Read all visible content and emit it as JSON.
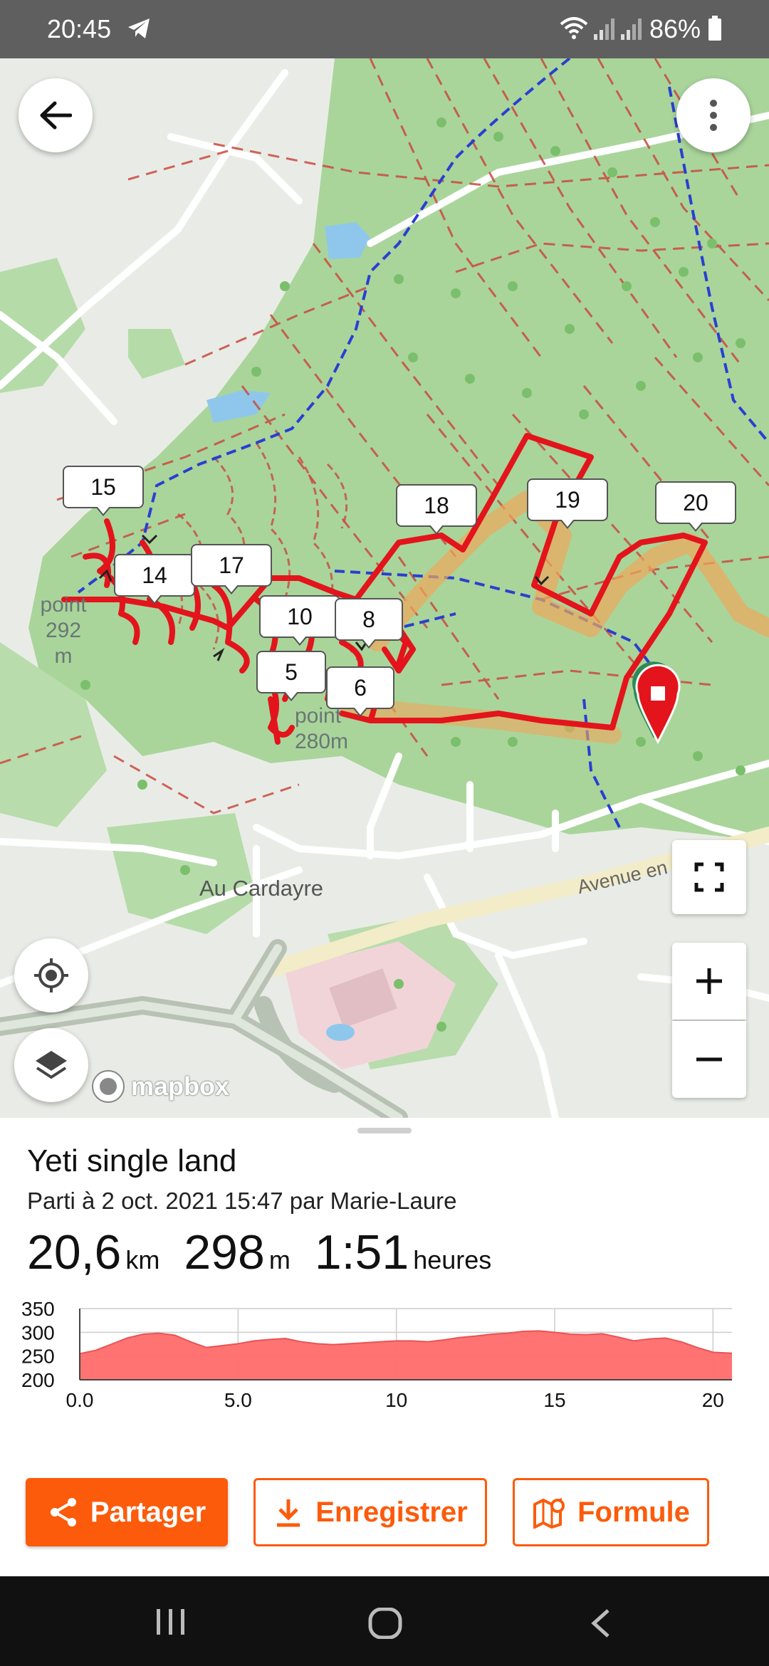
{
  "status_bar": {
    "time": "20:45",
    "battery": "86%"
  },
  "map": {
    "waypoint_labels": [
      "15",
      "14",
      "17",
      "10",
      "8",
      "5",
      "6",
      "18",
      "19",
      "20"
    ],
    "labels": {
      "point_292": "point\n292\nm",
      "point_280_a": "point",
      "point_280_b": "280m",
      "place": "Au Cardayre",
      "road": "Avenue en"
    },
    "attribution": "mapbox",
    "icons": {
      "back": "arrow-left-icon",
      "more": "more-vertical-icon",
      "locate": "crosshair-icon",
      "layers": "layers-icon",
      "fullscreen": "fullscreen-icon",
      "zoom_in": "plus-icon",
      "zoom_out": "minus-icon"
    },
    "colors": {
      "route": "#e3141b",
      "forest": "#a8d59a",
      "trail": "#c94b3f",
      "water_path": "#2a3fd1"
    }
  },
  "activity": {
    "title": "Yeti single land",
    "subtitle": "Parti à 2 oct. 2021 15:47 par Marie-Laure",
    "distance_value": "20,6",
    "distance_unit": "km",
    "elevation_value": "298",
    "elevation_unit": "m",
    "duration_value": "1:51",
    "duration_unit": "heures"
  },
  "chart_data": {
    "type": "area",
    "x_ticks": [
      "0.0",
      "5.0",
      "10",
      "15",
      "20"
    ],
    "y_ticks": [
      "350",
      "300",
      "250",
      "200"
    ],
    "xlim": [
      0,
      20.6
    ],
    "ylim": [
      200,
      350
    ],
    "color": "#ff6b6b",
    "x": [
      0,
      0.5,
      1,
      1.5,
      2,
      2.5,
      3,
      3.5,
      4,
      4.5,
      5,
      5.5,
      6,
      6.5,
      7,
      7.5,
      8,
      8.5,
      9,
      9.5,
      10,
      10.5,
      11,
      11.5,
      12,
      12.5,
      13,
      13.5,
      14,
      14.5,
      15,
      15.5,
      16,
      16.5,
      17,
      17.5,
      18,
      18.5,
      19,
      19.5,
      20,
      20.6
    ],
    "y": [
      255,
      262,
      275,
      288,
      296,
      298,
      294,
      280,
      268,
      272,
      276,
      282,
      285,
      287,
      280,
      276,
      274,
      276,
      278,
      280,
      282,
      282,
      280,
      284,
      289,
      292,
      296,
      298,
      302,
      303,
      300,
      296,
      295,
      297,
      290,
      282,
      286,
      288,
      280,
      268,
      258,
      256
    ]
  },
  "buttons": {
    "share": "Partager",
    "save": "Enregistrer",
    "formula": "Formule"
  }
}
